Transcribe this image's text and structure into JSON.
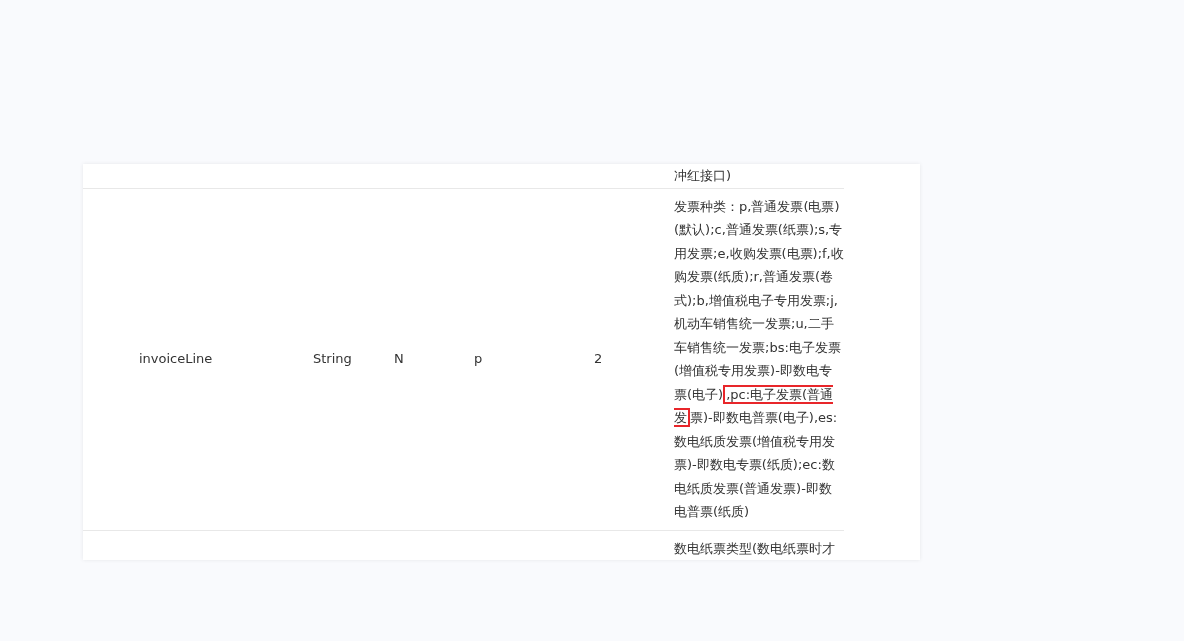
{
  "table": {
    "rows": [
      {
        "cells": [
          "",
          "",
          "",
          "",
          "",
          ""
        ],
        "description": [
          {
            "text": "冲红接口)",
            "highlighted": false
          }
        ]
      },
      {
        "cells": [
          "invoiceLine",
          "String",
          "N",
          "p",
          "2"
        ],
        "description": [
          {
            "text": "发票种类：p,普通发票(电票)(默认);c,普通发票(纸票);s,专用发票;e,收购发票(电票);f,收购发票(纸质);r,普通发票(卷式);b,增值税电子专用发票;j,机动车销售统一发票;u,二手车销售统一发票;bs:电子发票(增值税专用发票)-即数电专票(电子)",
            "highlighted": false
          },
          {
            "text": ",pc:电子发票(普通发",
            "highlighted": true
          },
          {
            "text": "票)-即数电普票(电子),es:数电纸质发票(增值税专用发票)-即数电专票(纸质);ec:数电纸质发票(普通发票)-即数电普票(纸质)",
            "highlighted": false
          }
        ]
      },
      {
        "cells": [
          "",
          "",
          "",
          "",
          ""
        ],
        "description": [
          {
            "text": "数电纸票类型(数电纸票时才",
            "highlighted": false
          }
        ]
      }
    ]
  }
}
